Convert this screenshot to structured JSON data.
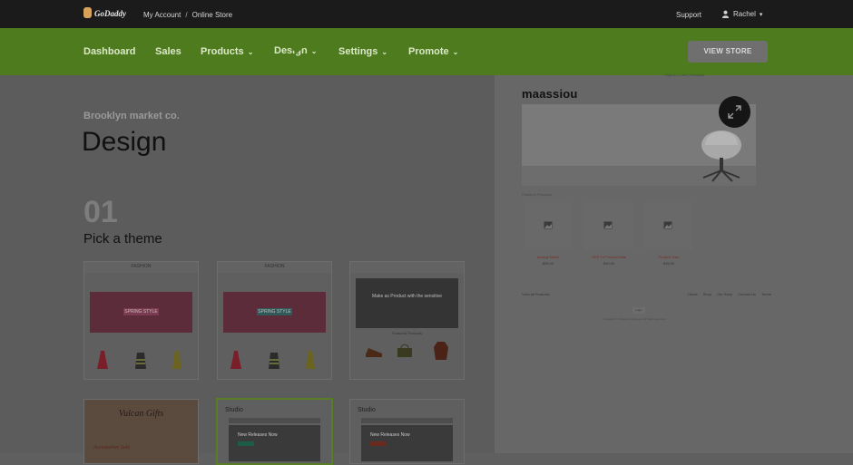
{
  "topbar": {
    "logo_text": "GoDaddy",
    "crumbs": [
      "My Account",
      "Online Store"
    ],
    "crumb_separator": "/",
    "support": "Support",
    "user": "Rachel"
  },
  "nav": {
    "items": [
      "Dashboard",
      "Sales",
      "Products",
      "Design",
      "Settings",
      "Promote"
    ],
    "view_store": "VIEW STORE",
    "active": "Design"
  },
  "page": {
    "subtitle": "Brooklyn market co.",
    "title": "Design",
    "step_number": "01",
    "step_label": "Pick a theme"
  },
  "themes": {
    "fashion_brand": "FASHION",
    "spring_hero": "SPRING STYLE",
    "caption": "Featured Products",
    "hero_text": "Make as Product with the sensitive",
    "vintage_title": "Vulcan Gifts",
    "vintage_text": "Accessories Sale",
    "studio_label": "Studio",
    "studio_title": "New Releases Now"
  },
  "preview": {
    "store_name": "maassiou",
    "tiny_links": "Sign In | Cart | Checkout",
    "featured_label": "Featured Products",
    "products": [
      {
        "name": "Analog Watch",
        "price": "$35.00"
      },
      {
        "name": "GEP Fit Product Sale",
        "price": "$10.00"
      },
      {
        "name": "Product Sale",
        "price": "$45.00"
      }
    ],
    "footer_left": "View all Products",
    "footer_links": [
      "Home",
      "Shop",
      "Our Story",
      "Contact Us",
      "Terms"
    ],
    "login": "Login",
    "copyright": "Copyright © Brooklyn market co. All rights reserved."
  },
  "colors": {
    "topbar": "#1b1b1b",
    "nav": "#4e7b1d",
    "overlay_bg": "#5f5f60"
  }
}
